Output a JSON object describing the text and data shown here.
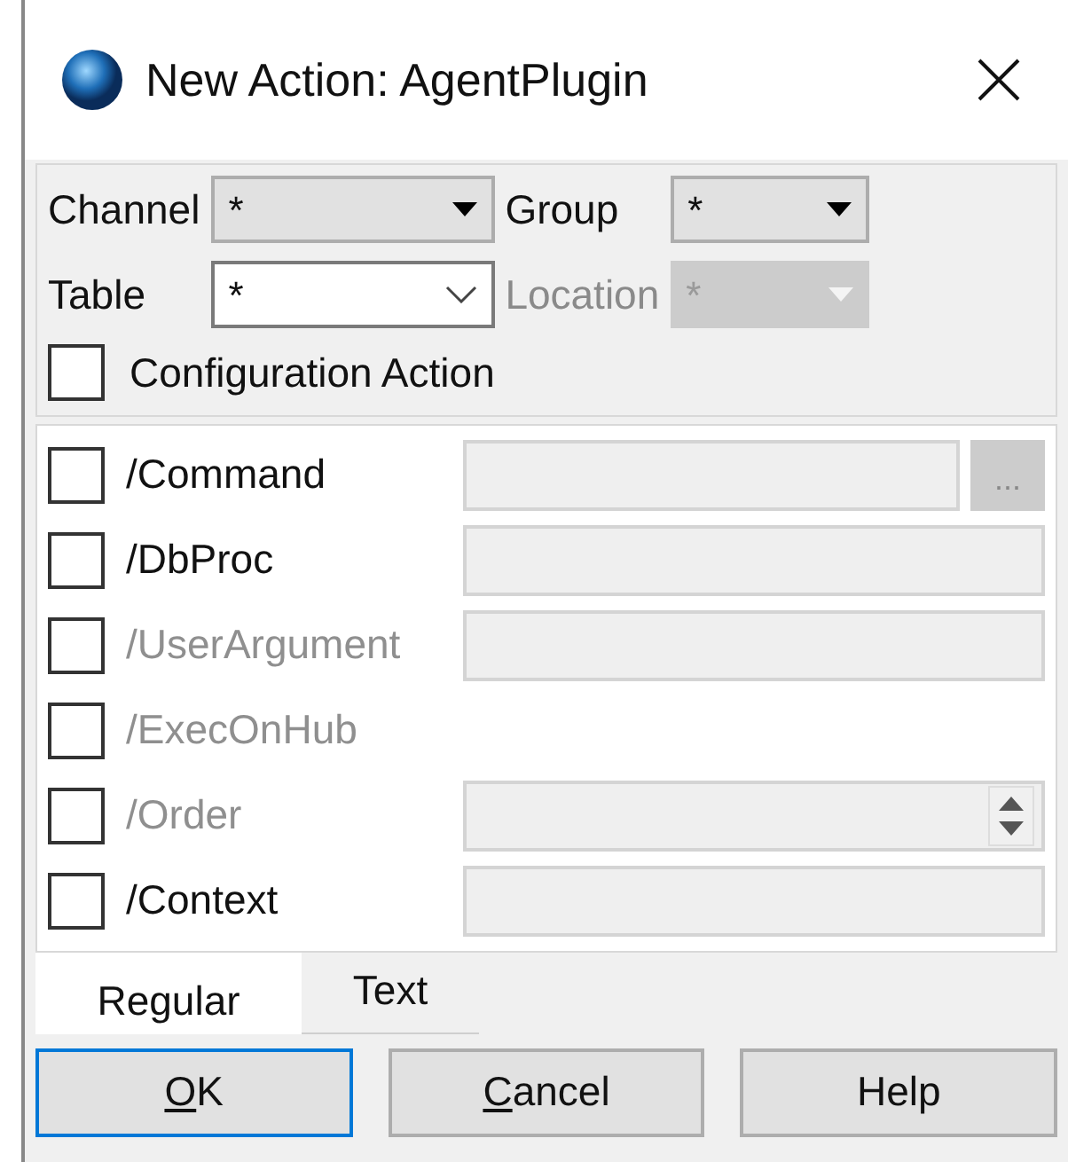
{
  "window": {
    "title": "New Action: AgentPlugin"
  },
  "filters": [
    {
      "label": "Channel",
      "value": "*",
      "disabled": false,
      "kind": "dropdown"
    },
    {
      "label": "Group",
      "value": "*",
      "disabled": false,
      "kind": "dropdown"
    },
    {
      "label": "Table",
      "value": "*",
      "disabled": false,
      "kind": "editable"
    },
    {
      "label": "Location",
      "value": "*",
      "disabled": true,
      "kind": "dropdown"
    }
  ],
  "configuration_action": {
    "label": "Configuration Action",
    "checked": false
  },
  "options": [
    {
      "label": "/Command",
      "checked": false,
      "disabled": false,
      "kind": "browse",
      "browse": "..."
    },
    {
      "label": "/DbProc",
      "checked": false,
      "disabled": false,
      "kind": "text"
    },
    {
      "label": "/UserArgument",
      "checked": false,
      "disabled": true,
      "kind": "text"
    },
    {
      "label": "/ExecOnHub",
      "checked": false,
      "disabled": true,
      "kind": "none"
    },
    {
      "label": "/Order",
      "checked": false,
      "disabled": true,
      "kind": "spinner"
    },
    {
      "label": "/Context",
      "checked": false,
      "disabled": false,
      "kind": "text"
    }
  ],
  "tabs": [
    {
      "label": "Regular",
      "selected": true
    },
    {
      "label": "Text",
      "selected": false
    }
  ],
  "buttons": [
    {
      "underlined": "O",
      "label": "K",
      "focused": true
    },
    {
      "underlined": "C",
      "label": "ancel",
      "focused": false
    },
    {
      "label": "Help",
      "focused": false
    }
  ]
}
